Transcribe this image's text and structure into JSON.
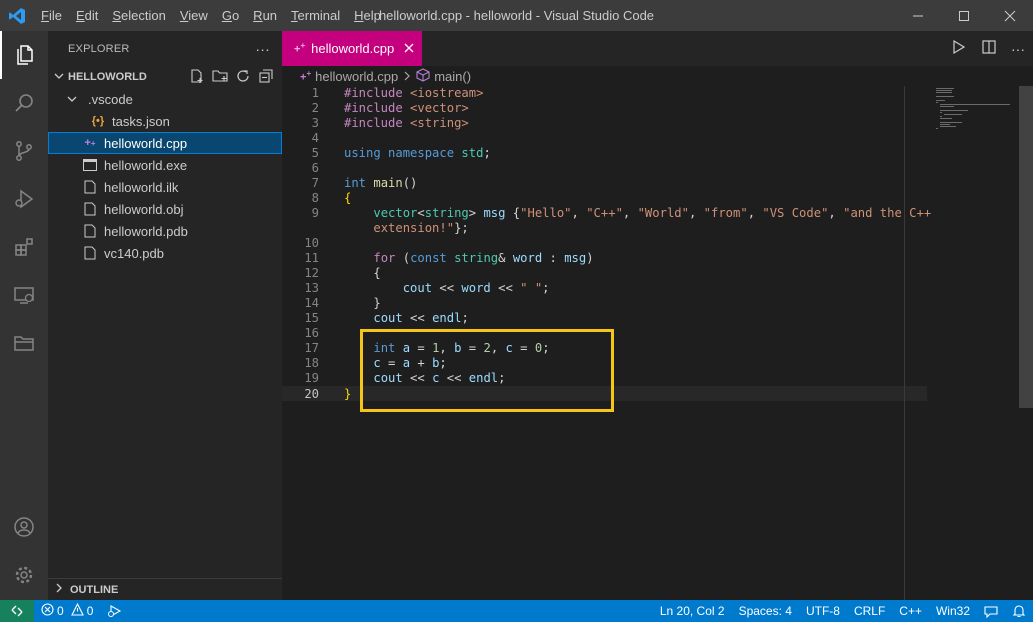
{
  "window": {
    "title": "helloworld.cpp - helloworld - Visual Studio Code"
  },
  "menu": [
    {
      "label": "File",
      "mnemonic": "F",
      "rest": "ile"
    },
    {
      "label": "Edit",
      "mnemonic": "E",
      "rest": "dit"
    },
    {
      "label": "Selection",
      "mnemonic": "S",
      "rest": "election"
    },
    {
      "label": "View",
      "mnemonic": "V",
      "rest": "iew"
    },
    {
      "label": "Go",
      "mnemonic": "G",
      "rest": "o"
    },
    {
      "label": "Run",
      "mnemonic": "R",
      "rest": "un"
    },
    {
      "label": "Terminal",
      "mnemonic": "T",
      "rest": "erminal"
    },
    {
      "label": "Help",
      "mnemonic": "H",
      "rest": "elp"
    }
  ],
  "explorer": {
    "header": "EXPLORER",
    "folder": "HELLOWORLD",
    "subfolder": ".vscode",
    "nested_file": "tasks.json",
    "files": [
      "helloworld.cpp",
      "helloworld.exe",
      "helloworld.ilk",
      "helloworld.obj",
      "helloworld.pdb",
      "vc140.pdb"
    ],
    "selected": "helloworld.cpp",
    "outline": "OUTLINE"
  },
  "tab": {
    "label": "helloworld.cpp",
    "color": "#c5007f"
  },
  "breadcrumb": {
    "file": "helloworld.cpp",
    "symbol": "main()"
  },
  "code_lines": [
    "#include <iostream>",
    "#include <vector>",
    "#include <string>",
    "",
    "using namespace std;",
    "",
    "int main()",
    "{",
    "    vector<string> msg {\"Hello\", \"C++\", \"World\", \"from\", \"VS Code\", \"and the C++ extension!\"};",
    "",
    "    for (const string& word : msg)",
    "    {",
    "        cout << word << \" \";",
    "    }",
    "    cout << endl;",
    "",
    "    int a = 1, b = 2, c = 0;",
    "    c = a + b;",
    "    cout << c << endl;",
    "}"
  ],
  "statusbar": {
    "errors": "0",
    "warnings": "0",
    "cursor": "Ln 20, Col 2",
    "spaces": "Spaces: 4",
    "encoding": "UTF-8",
    "eol": "CRLF",
    "language": "C++",
    "platform": "Win32"
  },
  "colors": {
    "statusbar": "#007acc",
    "highlight_box": "#f5c518",
    "selection": "#094771"
  }
}
